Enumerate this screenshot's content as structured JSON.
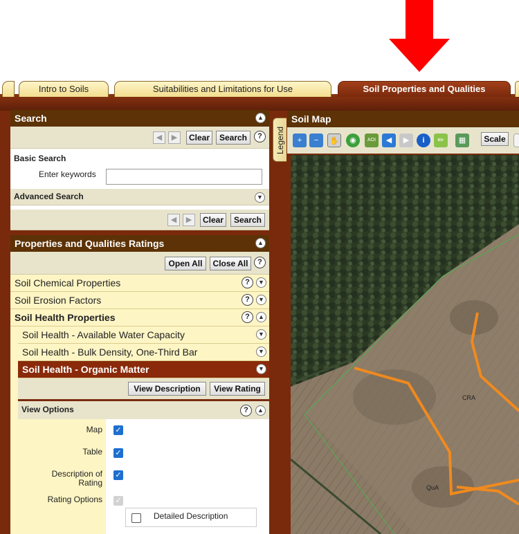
{
  "tabs": [
    {
      "label": "Intro to Soils",
      "active": false
    },
    {
      "label": "Suitabilities and Limitations for Use",
      "active": false
    },
    {
      "label": "Soil Properties and Qualities",
      "active": true
    }
  ],
  "search_panel": {
    "title": "Search",
    "clear_label": "Clear",
    "search_label": "Search",
    "basic_search_label": "Basic Search",
    "keywords_label": "Enter keywords",
    "keywords_value": "",
    "advanced_search_label": "Advanced Search"
  },
  "ratings_panel": {
    "title": "Properties and Qualities Ratings",
    "open_all_label": "Open All",
    "close_all_label": "Close All",
    "categories": [
      {
        "label": "Soil Chemical Properties"
      },
      {
        "label": "Soil Erosion Factors"
      },
      {
        "label": "Soil Health Properties"
      }
    ],
    "subitems": [
      {
        "label": "Soil Health - Available Water Capacity"
      },
      {
        "label": "Soil Health - Bulk Density, One-Third Bar"
      },
      {
        "label": "Soil Health - Organic Matter"
      }
    ],
    "view_description_label": "View Description",
    "view_rating_label": "View Rating",
    "view_options": {
      "title": "View Options",
      "map_label": "Map",
      "table_label": "Table",
      "description_label_1": "Description of",
      "description_label_2": "Rating",
      "rating_options_label": "Rating Options",
      "detailed_description_label": "Detailed Description",
      "map_checked": true,
      "table_checked": true,
      "description_checked": true,
      "detailed_description_checked": false
    }
  },
  "map_panel": {
    "title": "Soil Map",
    "legend_label": "Legend",
    "scale_label": "Scale",
    "map_units": [
      "CRA",
      "QuA"
    ]
  },
  "colors": {
    "header_brown": "#5c3206",
    "frame_rust": "#7a2a0c",
    "active_tab": "#8a2a0a",
    "row_yellow": "#fdf5c4",
    "soil_line_orange": "#f08a1e",
    "arrow_red": "#ff0000"
  }
}
